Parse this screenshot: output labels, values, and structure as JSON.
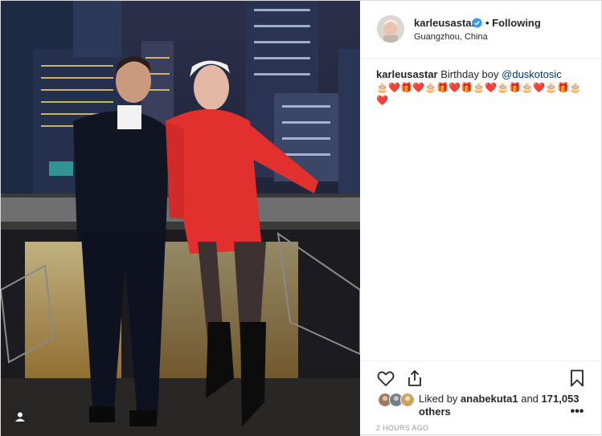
{
  "header": {
    "username": "karleusastar",
    "follow_label": "• Following",
    "location": "Guangzhou, China"
  },
  "caption": {
    "username": "karleusastar",
    "text": "Birthday boy",
    "mention": "@duskotosic",
    "emojis": [
      "🎂",
      "❤️",
      "🎁",
      "❤️",
      "🎂",
      "🎁",
      "❤️",
      "🎁",
      "🎂",
      "❤️",
      "🎂",
      "🎁",
      "🎂",
      "❤️",
      "🎂",
      "🎁",
      "🎂",
      "❤️"
    ]
  },
  "likes": {
    "prefix": "Liked by",
    "user": "anabekuta1",
    "joiner": "and",
    "count": "171,053 others"
  },
  "time": "2 HOURS AGO",
  "colors": {
    "dress": "#e2302e",
    "verified": "#3897f0",
    "text": "#262626"
  },
  "icons": {
    "like": "heart-icon",
    "share": "share-icon",
    "save": "bookmark-icon",
    "more": "more-icon",
    "tag": "user-tag-icon",
    "verified": "verified-badge-icon"
  }
}
